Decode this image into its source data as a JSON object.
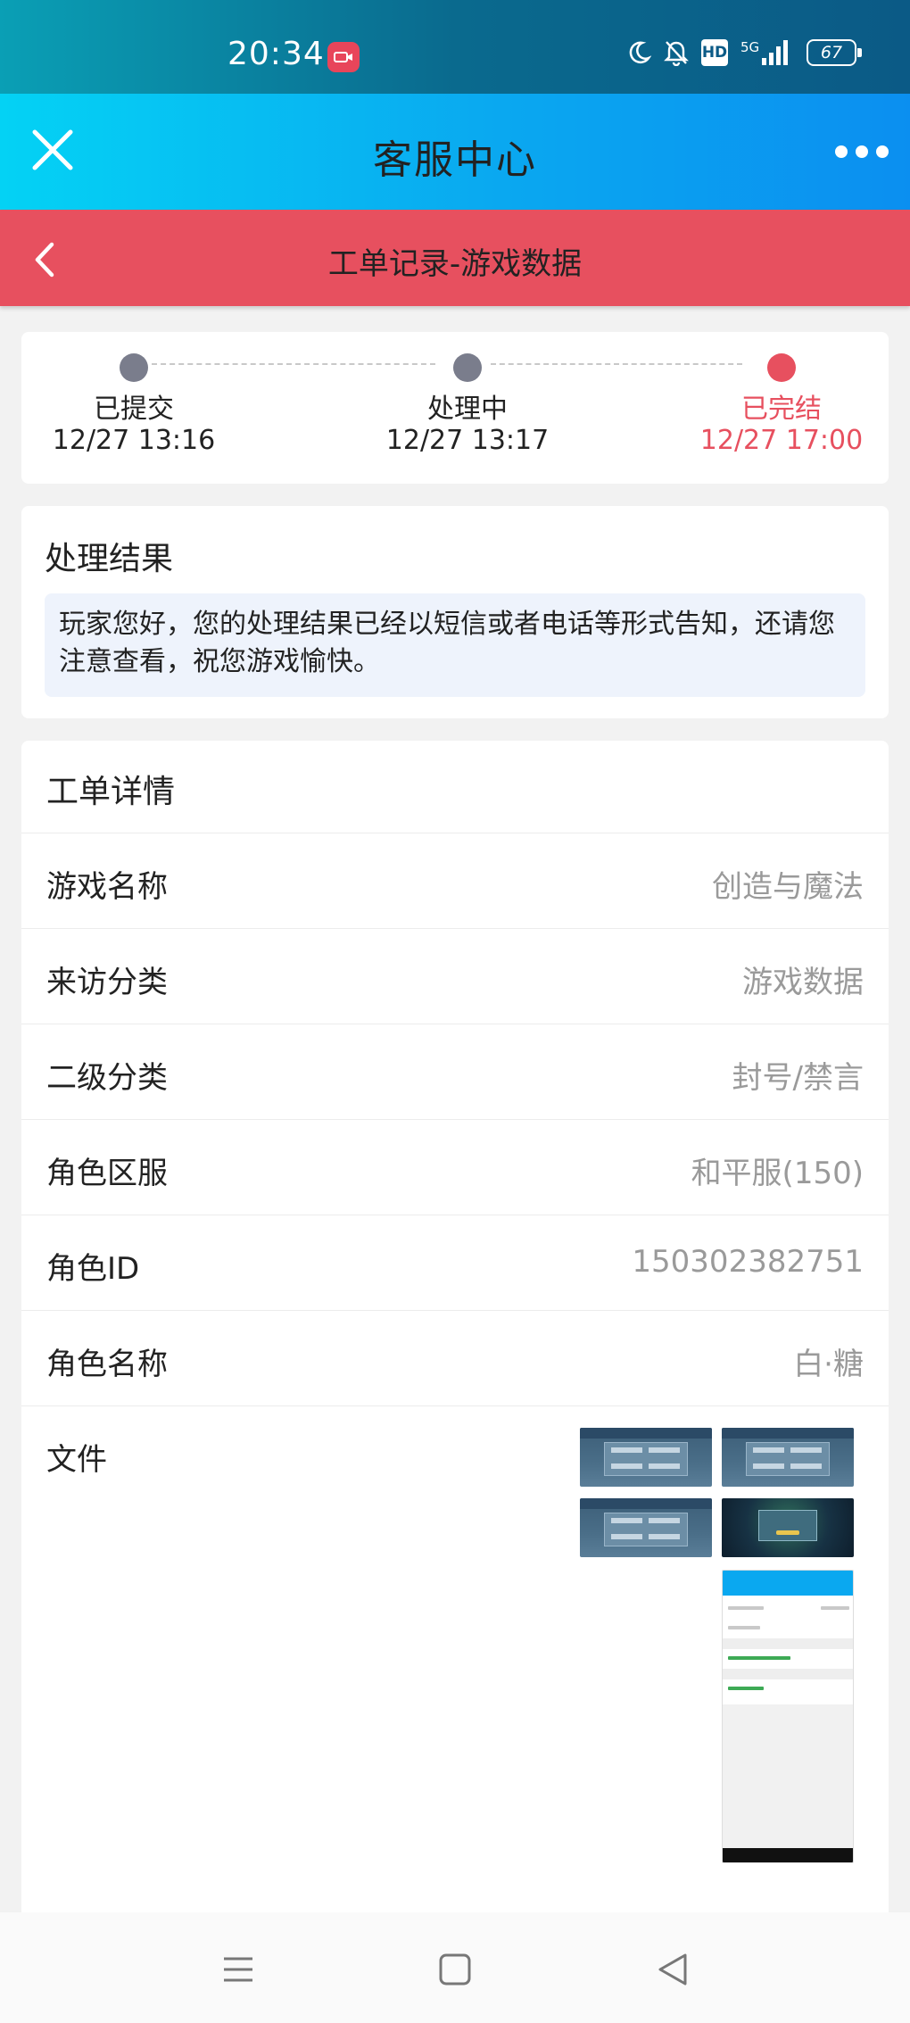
{
  "status_bar": {
    "time": "20:34",
    "network": "5G",
    "hd": "HD",
    "battery": "67",
    "icons": [
      "screen-record-icon",
      "moon-icon",
      "bell-mute-icon",
      "hd-icon",
      "signal-5g-icon",
      "battery-icon"
    ]
  },
  "header": {
    "title": "客服中心",
    "close_icon": "close-icon",
    "more_icon": "more-icon"
  },
  "sub_header": {
    "title": "工单记录-游戏数据",
    "back_icon": "chevron-left-icon"
  },
  "progress": {
    "steps": [
      {
        "label": "已提交",
        "time": "12/27 13:16",
        "status": "done"
      },
      {
        "label": "处理中",
        "time": "12/27 13:17",
        "status": "done"
      },
      {
        "label": "已完结",
        "time": "12/27 17:00",
        "status": "current"
      }
    ],
    "active_color": "#e7505f",
    "inactive_color": "#7a7d8c"
  },
  "result": {
    "title": "处理结果",
    "text": "玩家您好，您的处理结果已经以短信或者电话等形式告知，还请您注意查看，祝您游戏愉快。"
  },
  "details": {
    "title": "工单详情",
    "rows": [
      {
        "key": "游戏名称",
        "value": "创造与魔法"
      },
      {
        "key": "来访分类",
        "value": "游戏数据"
      },
      {
        "key": "二级分类",
        "value": "封号/禁言"
      },
      {
        "key": "角色区服",
        "value": "和平服(150)"
      },
      {
        "key": "角色ID",
        "value": "150302382751"
      },
      {
        "key": "角色名称",
        "value": "白·糖"
      }
    ],
    "files_label": "文件",
    "files": [
      "game-screenshot",
      "game-screenshot",
      "game-screenshot",
      "game-night-screenshot",
      "phone-screenshot"
    ]
  },
  "bottom_nav": {
    "icons": [
      "menu-icon",
      "home-icon",
      "back-icon"
    ]
  },
  "colors": {
    "header_gradient_start": "#04d2f4",
    "header_gradient_end": "#0b8ff0",
    "sub_header": "#e7505f",
    "result_box": "#eef3fc"
  }
}
